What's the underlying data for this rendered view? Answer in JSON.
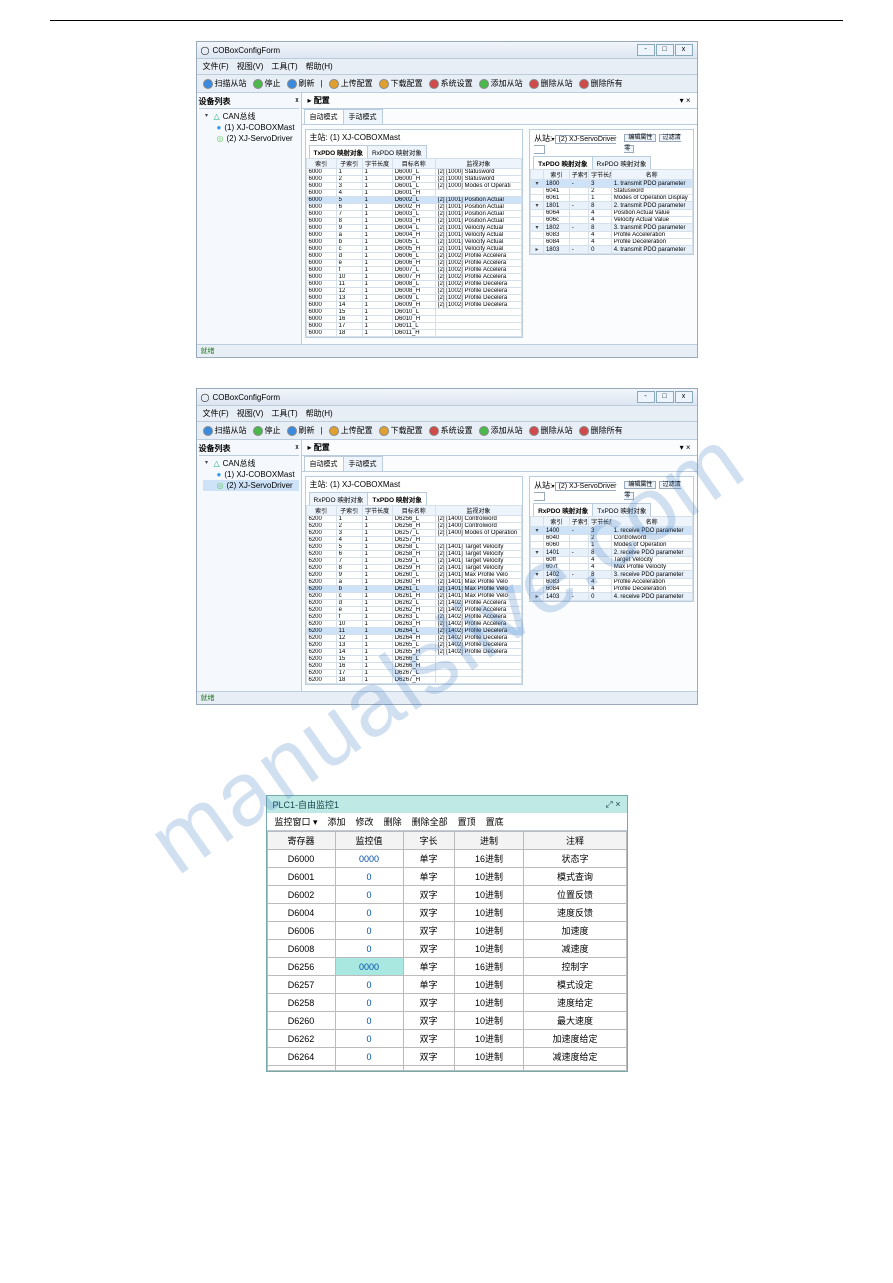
{
  "watermark": "manualslive.com",
  "app": {
    "title": "COBoxConfigForm",
    "menus": [
      "文件(F)",
      "视图(V)",
      "工具(T)",
      "帮助(H)"
    ],
    "toolbar": [
      "扫描从站",
      "停止",
      "刷新",
      "上传配置",
      "下载配置",
      "系统设置",
      "添加从站",
      "删除从站",
      "删除所有"
    ],
    "sidepanel_title": "设备列表",
    "tree_root": "CAN总线",
    "tree_items": [
      "(1) XJ-COBOXMast",
      "(2) XJ-ServoDriver"
    ],
    "cfg_tab": "配置",
    "mode_tabs": [
      "自动模式",
      "手动模式"
    ],
    "master_label": "主站:",
    "master_value": "(1) XJ-COBOXMast",
    "slave_label": "从站:",
    "slave_value": "(2) XJ-ServoDriver",
    "subtabs_left_1": [
      "TxPDO 映射对象",
      "RxPDO 映射对象"
    ],
    "subtabs_left_2": [
      "RxPDO 映射对象",
      "TxPDO 映射对象"
    ],
    "subtabs_right": [
      "TxPDO 映射对象",
      "RxPDO 映射对象"
    ],
    "subtabs_right_2": [
      "RxPDO 映射对象",
      "TxPDO 映射对象"
    ],
    "btn_edit": "编辑属性",
    "btn_filter": "过滤清零",
    "left_headers": [
      "索引",
      "子索引",
      "字节长度",
      "目标名称",
      "监视对象"
    ],
    "right_headers": [
      "",
      "索引",
      "子索引",
      "字节长度",
      "名称"
    ],
    "status": "就绪"
  },
  "win1_left_rows": [
    {
      "a": "6000",
      "b": "1",
      "c": "1",
      "d": "D6000_L",
      "e": "[2] [1000] Statusword"
    },
    {
      "a": "6000",
      "b": "2",
      "c": "1",
      "d": "D6000_H",
      "e": "[2] [1000] Statusword"
    },
    {
      "a": "6000",
      "b": "3",
      "c": "1",
      "d": "D6001_L",
      "e": "[2] [1000] Modes of Operati"
    },
    {
      "a": "6000",
      "b": "4",
      "c": "1",
      "d": "D6001_H",
      "e": ""
    },
    {
      "a": "6000",
      "b": "5",
      "c": "1",
      "d": "D6002_L",
      "e": "[2] [1001] Position Actual",
      "hl": true
    },
    {
      "a": "6000",
      "b": "6",
      "c": "1",
      "d": "D6002_H",
      "e": "[2] [1001] Position Actual"
    },
    {
      "a": "6000",
      "b": "7",
      "c": "1",
      "d": "D6003_L",
      "e": "[2] [1001] Position Actual"
    },
    {
      "a": "6000",
      "b": "8",
      "c": "1",
      "d": "D6003_H",
      "e": "[2] [1001] Position Actual"
    },
    {
      "a": "6000",
      "b": "9",
      "c": "1",
      "d": "D6004_L",
      "e": "[2] [1001] Velocity Actual"
    },
    {
      "a": "6000",
      "b": "a",
      "c": "1",
      "d": "D6004_H",
      "e": "[2] [1001] Velocity Actual"
    },
    {
      "a": "6000",
      "b": "b",
      "c": "1",
      "d": "D6005_L",
      "e": "[2] [1001] Velocity Actual"
    },
    {
      "a": "6000",
      "b": "c",
      "c": "1",
      "d": "D6005_H",
      "e": "[2] [1001] Velocity Actual"
    },
    {
      "a": "6000",
      "b": "d",
      "c": "1",
      "d": "D6006_L",
      "e": "[2] [1002] Profile Accelera"
    },
    {
      "a": "6000",
      "b": "e",
      "c": "1",
      "d": "D6006_H",
      "e": "[2] [1002] Profile Accelera"
    },
    {
      "a": "6000",
      "b": "f",
      "c": "1",
      "d": "D6007_L",
      "e": "[2] [1002] Profile Accelera"
    },
    {
      "a": "6000",
      "b": "10",
      "c": "1",
      "d": "D6007_H",
      "e": "[2] [1002] Profile Accelera"
    },
    {
      "a": "6000",
      "b": "11",
      "c": "1",
      "d": "D6008_L",
      "e": "[2] [1002] Profile Decelera"
    },
    {
      "a": "6000",
      "b": "12",
      "c": "1",
      "d": "D6008_H",
      "e": "[2] [1002] Profile Decelera"
    },
    {
      "a": "6000",
      "b": "13",
      "c": "1",
      "d": "D6009_L",
      "e": "[2] [1002] Profile Decelera"
    },
    {
      "a": "6000",
      "b": "14",
      "c": "1",
      "d": "D6009_H",
      "e": "[2] [1002] Profile Decelera"
    },
    {
      "a": "6000",
      "b": "15",
      "c": "1",
      "d": "D6010_L",
      "e": ""
    },
    {
      "a": "6000",
      "b": "16",
      "c": "1",
      "d": "D6010_H",
      "e": ""
    },
    {
      "a": "6000",
      "b": "17",
      "c": "1",
      "d": "D6011_L",
      "e": ""
    },
    {
      "a": "6000",
      "b": "18",
      "c": "1",
      "d": "D6011_H",
      "e": ""
    }
  ],
  "win1_right_rows": [
    {
      "ex": "▾",
      "a": "1800",
      "b": "-",
      "c": "3",
      "d": "1. transmit PDO parameter",
      "hl": true
    },
    {
      "ex": "",
      "a": "6041",
      "b": "",
      "c": "2",
      "d": "Statusword"
    },
    {
      "ex": "",
      "a": "6061",
      "b": "",
      "c": "1",
      "d": "Modes of Operation Display"
    },
    {
      "ex": "▾",
      "a": "1801",
      "b": "-",
      "c": "8",
      "d": "2. transmit PDO parameter",
      "hl2": true
    },
    {
      "ex": "",
      "a": "6064",
      "b": "",
      "c": "4",
      "d": "Position Actual Value"
    },
    {
      "ex": "",
      "a": "606c",
      "b": "",
      "c": "4",
      "d": "Velocity Actual Value"
    },
    {
      "ex": "▾",
      "a": "1802",
      "b": "-",
      "c": "8",
      "d": "3. transmit PDO parameter",
      "hl2": true
    },
    {
      "ex": "",
      "a": "6083",
      "b": "",
      "c": "4",
      "d": "Profile Acceleration"
    },
    {
      "ex": "",
      "a": "6084",
      "b": "",
      "c": "4",
      "d": "Profile Deceleration"
    },
    {
      "ex": "▸",
      "a": "1803",
      "b": "-",
      "c": "0",
      "d": "4. transmit PDO parameter",
      "hl2": true
    }
  ],
  "win2_left_rows": [
    {
      "a": "6200",
      "b": "1",
      "c": "1",
      "d": "D6256_L",
      "e": "[2] [1400] Controlword"
    },
    {
      "a": "6200",
      "b": "2",
      "c": "1",
      "d": "D6256_H",
      "e": "[2] [1400] Controlword"
    },
    {
      "a": "6200",
      "b": "3",
      "c": "1",
      "d": "D6257_L",
      "e": "[2] [1400] Modes of Operation"
    },
    {
      "a": "6200",
      "b": "4",
      "c": "1",
      "d": "D6257_H",
      "e": ""
    },
    {
      "a": "6200",
      "b": "5",
      "c": "1",
      "d": "D6258_L",
      "e": "[2] [1401] Target Velocity"
    },
    {
      "a": "6200",
      "b": "6",
      "c": "1",
      "d": "D6258_H",
      "e": "[2] [1401] Target Velocity"
    },
    {
      "a": "6200",
      "b": "7",
      "c": "1",
      "d": "D6259_L",
      "e": "[2] [1401] Target Velocity"
    },
    {
      "a": "6200",
      "b": "8",
      "c": "1",
      "d": "D6259_H",
      "e": "[2] [1401] Target Velocity"
    },
    {
      "a": "6200",
      "b": "9",
      "c": "1",
      "d": "D6260_L",
      "e": "[2] [1401] Max Profile Velo"
    },
    {
      "a": "6200",
      "b": "a",
      "c": "1",
      "d": "D6260_H",
      "e": "[2] [1401] Max Profile Velo"
    },
    {
      "a": "6200",
      "b": "b",
      "c": "1",
      "d": "D6261_L",
      "e": "[2] [1401] Max Profile Velo",
      "hl": true
    },
    {
      "a": "6200",
      "b": "c",
      "c": "1",
      "d": "D6261_H",
      "e": "[2] [1401] Max Profile Velo"
    },
    {
      "a": "6200",
      "b": "d",
      "c": "1",
      "d": "D6262_L",
      "e": "[2] [1402] Profile Accelera"
    },
    {
      "a": "6200",
      "b": "e",
      "c": "1",
      "d": "D6262_H",
      "e": "[2] [1402] Profile Accelera"
    },
    {
      "a": "6200",
      "b": "f",
      "c": "1",
      "d": "D6263_L",
      "e": "[2] [1402] Profile Accelera"
    },
    {
      "a": "6200",
      "b": "10",
      "c": "1",
      "d": "D6263_H",
      "e": "[2] [1402] Profile Accelera"
    },
    {
      "a": "6200",
      "b": "11",
      "c": "1",
      "d": "D6264_L",
      "e": "[2] [1402] Profile Decelera",
      "hl": true
    },
    {
      "a": "6200",
      "b": "12",
      "c": "1",
      "d": "D6264_H",
      "e": "[2] [1402] Profile Decelera"
    },
    {
      "a": "6200",
      "b": "13",
      "c": "1",
      "d": "D6265_L",
      "e": "[2] [1402] Profile Decelera"
    },
    {
      "a": "6200",
      "b": "14",
      "c": "1",
      "d": "D6265_H",
      "e": "[2] [1402] Profile Decelera"
    },
    {
      "a": "6200",
      "b": "15",
      "c": "1",
      "d": "D6266_L",
      "e": ""
    },
    {
      "a": "6200",
      "b": "16",
      "c": "1",
      "d": "D6266_H",
      "e": ""
    },
    {
      "a": "6200",
      "b": "17",
      "c": "1",
      "d": "D6267_L",
      "e": ""
    },
    {
      "a": "6200",
      "b": "18",
      "c": "1",
      "d": "D6267_H",
      "e": ""
    }
  ],
  "win2_right_rows": [
    {
      "ex": "▾",
      "a": "1400",
      "b": "-",
      "c": "3",
      "d": "1. receive PDO parameter",
      "hl": true
    },
    {
      "ex": "",
      "a": "6040",
      "b": "",
      "c": "2",
      "d": "Controlword"
    },
    {
      "ex": "",
      "a": "6060",
      "b": "",
      "c": "1",
      "d": "Modes of Operation"
    },
    {
      "ex": "▾",
      "a": "1401",
      "b": "-",
      "c": "8",
      "d": "2. receive PDO parameter",
      "hl2": true
    },
    {
      "ex": "",
      "a": "60ff",
      "b": "",
      "c": "4",
      "d": "Target Velocity"
    },
    {
      "ex": "",
      "a": "607f",
      "b": "",
      "c": "4",
      "d": "Max Profile Velocity"
    },
    {
      "ex": "▾",
      "a": "1402",
      "b": "-",
      "c": "8",
      "d": "3. receive PDO parameter",
      "hl2": true
    },
    {
      "ex": "",
      "a": "6083",
      "b": "",
      "c": "4",
      "d": "Profile Acceleration"
    },
    {
      "ex": "",
      "a": "6084",
      "b": "",
      "c": "4",
      "d": "Profile Deceleration"
    },
    {
      "ex": "▸",
      "a": "1403",
      "b": "-",
      "c": "0",
      "d": "4. receive PDO parameter",
      "hl2": true
    }
  ],
  "plc": {
    "title": "PLC1-自由监控1",
    "bar": [
      "监控窗口 ▾",
      "添加",
      "修改",
      "删除",
      "删除全部",
      "置顶",
      "置底"
    ],
    "headers": [
      "寄存器",
      "监控值",
      "字长",
      "进制",
      "注释"
    ],
    "rows": [
      {
        "r": "D6000",
        "v": "0000",
        "w": "单字",
        "b": "16进制",
        "n": "状态字"
      },
      {
        "r": "D6001",
        "v": "0",
        "w": "单字",
        "b": "10进制",
        "n": "模式查询"
      },
      {
        "r": "D6002",
        "v": "0",
        "w": "双字",
        "b": "10进制",
        "n": "位置反馈"
      },
      {
        "r": "D6004",
        "v": "0",
        "w": "双字",
        "b": "10进制",
        "n": "速度反馈"
      },
      {
        "r": "D6006",
        "v": "0",
        "w": "双字",
        "b": "10进制",
        "n": "加速度"
      },
      {
        "r": "D6008",
        "v": "0",
        "w": "双字",
        "b": "10进制",
        "n": "减速度"
      },
      {
        "r": "D6256",
        "v": "0000",
        "w": "单字",
        "b": "16进制",
        "n": "控制字",
        "hl": true
      },
      {
        "r": "D6257",
        "v": "0",
        "w": "单字",
        "b": "10进制",
        "n": "模式设定"
      },
      {
        "r": "D6258",
        "v": "0",
        "w": "双字",
        "b": "10进制",
        "n": "速度给定"
      },
      {
        "r": "D6260",
        "v": "0",
        "w": "双字",
        "b": "10进制",
        "n": "最大速度"
      },
      {
        "r": "D6262",
        "v": "0",
        "w": "双字",
        "b": "10进制",
        "n": "加速度给定"
      },
      {
        "r": "D6264",
        "v": "0",
        "w": "双字",
        "b": "10进制",
        "n": "减速度给定"
      },
      {
        "r": "",
        "v": "",
        "w": "",
        "b": "",
        "n": ""
      }
    ]
  }
}
